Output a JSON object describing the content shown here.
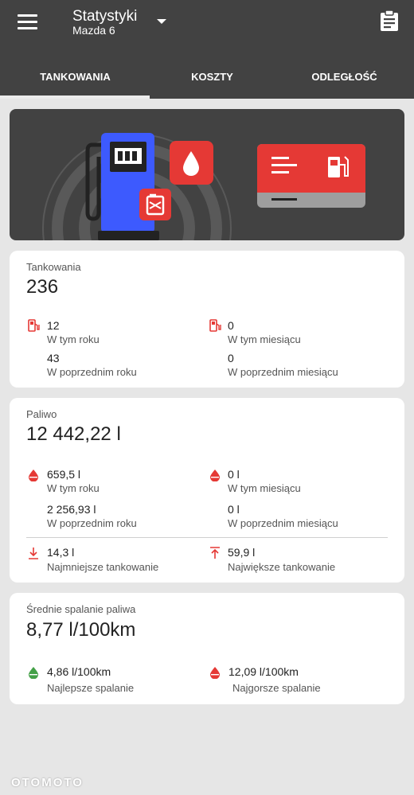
{
  "header": {
    "title": "Statystyki",
    "subtitle": "Mazda 6",
    "icons": {
      "menu": "hamburger-menu-icon",
      "dropdown": "chevron-down-icon",
      "action": "clipboard-icon"
    }
  },
  "tabs": [
    {
      "label": "TANKOWANIA",
      "active": true
    },
    {
      "label": "KOSZTY",
      "active": false
    },
    {
      "label": "ODLEGŁOŚĆ",
      "active": false
    }
  ],
  "refuels": {
    "label": "Tankowania",
    "value": "236",
    "stats": [
      {
        "value": "12",
        "label": "W tym roku",
        "icon": "fuel-pump-icon"
      },
      {
        "value": "0",
        "label": "W tym miesiącu",
        "icon": "fuel-pump-icon"
      },
      {
        "value": "43",
        "label": "W poprzednim roku"
      },
      {
        "value": "0",
        "label": "W poprzednim miesiącu"
      }
    ]
  },
  "fuel": {
    "label": "Paliwo",
    "value": "12 442,22 l",
    "stats": [
      {
        "value": "659,5 l",
        "label": "W tym roku",
        "icon": "fuel-drop-icon"
      },
      {
        "value": "0 l",
        "label": "W tym miesiącu",
        "icon": "fuel-drop-icon"
      },
      {
        "value": "2 256,93 l",
        "label": "W poprzednim roku"
      },
      {
        "value": "0 l",
        "label": "W poprzednim miesiącu"
      },
      {
        "value": "14,3 l",
        "label": "Najmniejsze tankowanie",
        "icon": "arrow-down-icon"
      },
      {
        "value": "59,9 l",
        "label": "Największe tankowanie",
        "icon": "arrow-up-icon"
      }
    ]
  },
  "consumption": {
    "label": "Średnie spalanie paliwa",
    "value": "8,77 l/100km",
    "stats": [
      {
        "value": "4,86 l/100km",
        "label": "Najlepsze spalanie",
        "icon": "green-drop-icon"
      },
      {
        "value": "12,09 l/100km",
        "label": "Najgorsze spalanie",
        "icon": "red-drop-icon"
      }
    ]
  },
  "watermark": "OTOMOTO",
  "colors": {
    "appbar": "#424242",
    "accent_red": "#e53935",
    "pump_blue": "#3d5afe",
    "good_green": "#43a047",
    "background": "#e6e6e6"
  }
}
